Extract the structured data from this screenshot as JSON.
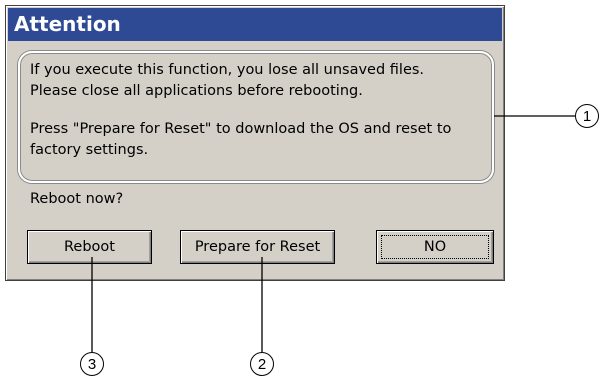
{
  "dialog": {
    "title": "Attention",
    "message_lines": [
      "If you execute this function, you lose all unsaved files.",
      "Please close all applications before rebooting.",
      "Press \"Prepare for Reset\" to download the OS and reset to",
      "factory settings."
    ],
    "question": "Reboot now?",
    "buttons": {
      "reboot": "Reboot",
      "prepare_reset": "Prepare for Reset",
      "no": "NO"
    }
  },
  "callouts": {
    "one": "1",
    "two": "2",
    "three": "3"
  },
  "colors": {
    "titlebar": "#2e4a95",
    "dialog_bg": "#d4d0c8"
  }
}
